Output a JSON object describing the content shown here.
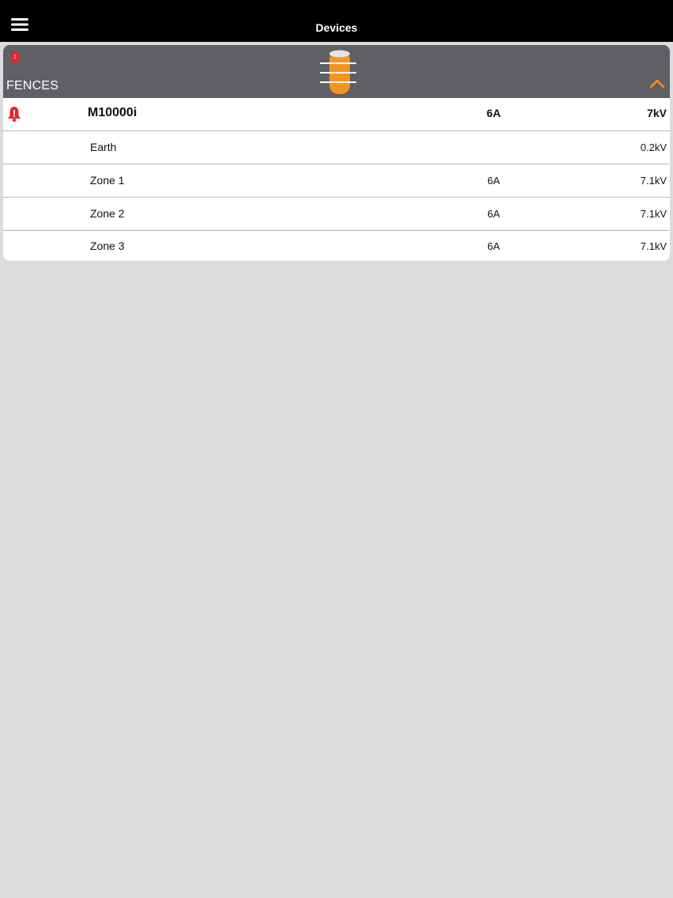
{
  "topbar": {
    "title": "Devices",
    "menu_icon": "hamburger-menu-icon"
  },
  "group": {
    "label": "FENCES",
    "alarm_count": "1",
    "group_icon": "fence-post-icon",
    "collapse_icon": "chevron-up-icon",
    "accent_color": "#f7931e",
    "header_color": "#5e6063"
  },
  "device": {
    "name": "M10000i",
    "current": "6A",
    "voltage": "7kV",
    "alarm_icon": "bell-alarm-icon",
    "alarm_color": "#e8212b"
  },
  "readings": [
    {
      "name": "Earth",
      "current": "",
      "voltage": "0.2kV"
    },
    {
      "name": "Zone 1",
      "current": "6A",
      "voltage": "7.1kV"
    },
    {
      "name": "Zone 2",
      "current": "6A",
      "voltage": "7.1kV"
    },
    {
      "name": "Zone 3",
      "current": "6A",
      "voltage": "7.1kV"
    }
  ]
}
